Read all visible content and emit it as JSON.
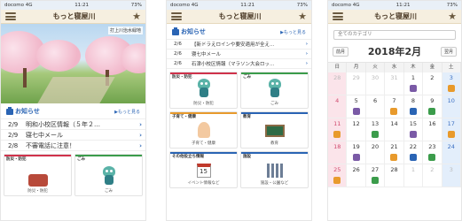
{
  "app_title": "もっと寝屋川",
  "status_left": "docomo 4G",
  "status_time": "11:21",
  "status_right": "73%",
  "photo_caption": "打上川治水緑地",
  "notices": {
    "title": "お知らせ",
    "more": "▶もっと見る",
    "items": [
      {
        "date": "2/9",
        "text": "明和小校区情報（５年２…"
      },
      {
        "date": "2/9",
        "text": "寝七中メール"
      },
      {
        "date": "2/8",
        "text": "不審電話に注意！"
      }
    ]
  },
  "notices2": {
    "items": [
      {
        "date": "2/6",
        "text": "【新ドラえロインや要安適用が全え…"
      },
      {
        "date": "2/6",
        "text": "寝七中メール"
      },
      {
        "date": "2/6",
        "text": "石津小校区情報（マラソン大会ロッ…"
      }
    ]
  },
  "tiles": {
    "disaster": {
      "top": "防災・防犯",
      "cap": "防災・防犯"
    },
    "garbage": {
      "top": "ごみ",
      "cap": "ごみ"
    },
    "childcare": {
      "top": "子育て・健康",
      "cap": "子育て・健康"
    },
    "education": {
      "top": "教育",
      "cap": "教育"
    },
    "events": {
      "top": "その他役立ち情報",
      "cap": "イベント情報など",
      "date": "15"
    },
    "facilities": {
      "top": "施設",
      "cap": "施設・公園など"
    }
  },
  "calendar": {
    "filter_placeholder": "全てのカテゴリ",
    "prev": "前月",
    "next": "翌月",
    "month": "2018年2月",
    "dows": [
      "日",
      "月",
      "火",
      "水",
      "木",
      "金",
      "土"
    ],
    "weeks": [
      [
        "28",
        "29",
        "30",
        "31",
        "1",
        "2",
        "3"
      ],
      [
        "4",
        "5",
        "6",
        "7",
        "8",
        "9",
        "10"
      ],
      [
        "11",
        "12",
        "13",
        "14",
        "15",
        "16",
        "17"
      ],
      [
        "18",
        "19",
        "20",
        "21",
        "22",
        "23",
        "24"
      ],
      [
        "25",
        "26",
        "27",
        "28",
        "1",
        "2",
        "3"
      ]
    ]
  },
  "colors": {
    "accent": "#2a64b4",
    "header_bg": "#f6efe0",
    "red_line": "#d0324b",
    "green_line": "#3b9c4b"
  }
}
